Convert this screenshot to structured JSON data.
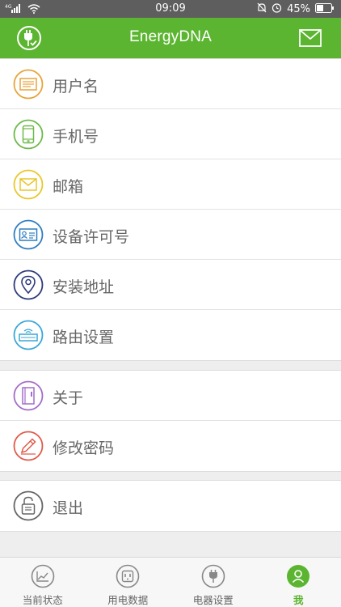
{
  "status": {
    "carrier": "4G",
    "time": "09:09",
    "battery": "45%"
  },
  "header": {
    "title": "EnergyDNA"
  },
  "menu": [
    {
      "label": "用户名",
      "icon": "id-card-icon",
      "color": "#e8a33a"
    },
    {
      "label": "手机号",
      "icon": "phone-icon",
      "color": "#6db94a"
    },
    {
      "label": "邮箱",
      "icon": "envelope-icon",
      "color": "#e8c72b"
    },
    {
      "label": "设备许可号",
      "icon": "license-card-icon",
      "color": "#2f7dc0"
    },
    {
      "label": "安装地址",
      "icon": "location-pin-icon",
      "color": "#2c3a7a"
    },
    {
      "label": "路由设置",
      "icon": "router-icon",
      "color": "#3aa7d6"
    }
  ],
  "menu2": [
    {
      "label": "关于",
      "icon": "book-icon",
      "color": "#a46cc8"
    },
    {
      "label": "修改密码",
      "icon": "pencil-icon",
      "color": "#e05a4a"
    }
  ],
  "menu3": [
    {
      "label": "退出",
      "icon": "unlock-icon",
      "color": "#666666"
    }
  ],
  "tabs": [
    {
      "label": "当前状态",
      "icon": "chart-icon"
    },
    {
      "label": "用电数据",
      "icon": "outlet-icon"
    },
    {
      "label": "电器设置",
      "icon": "plug-icon"
    },
    {
      "label": "我",
      "icon": "user-icon",
      "active": true
    }
  ],
  "colors": {
    "brand": "#5cb531",
    "statusbar": "#5e5e5e"
  }
}
